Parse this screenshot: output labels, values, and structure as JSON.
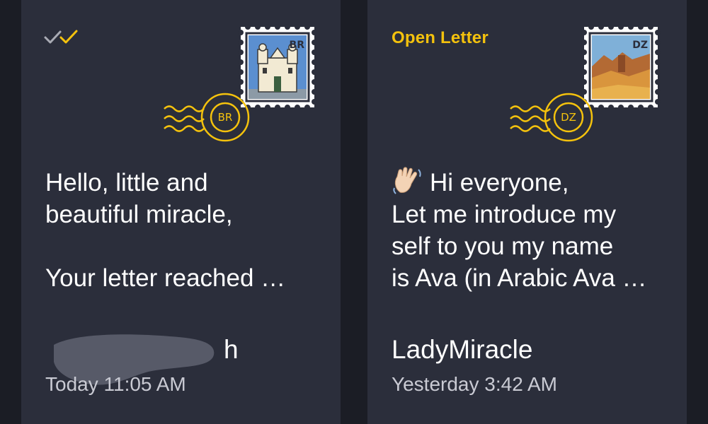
{
  "colors": {
    "background": "#1b1d25",
    "card": "#2b2e3b",
    "accent": "#f4c20d",
    "text": "#ffffff",
    "muted_text": "#c9cad3"
  },
  "letters": [
    {
      "status_icon": "double-check-icon",
      "stamp": {
        "country_code": "BR",
        "picture": "baroque church facade"
      },
      "postmark": {
        "code": "BR"
      },
      "preview_lines": [
        "Hello, little and",
        "beautiful miracle,",
        "",
        "Your letter reached …"
      ],
      "sender": "h",
      "timestamp": "Today 11:05 AM"
    },
    {
      "status_label": "Open Letter",
      "stamp": {
        "country_code": "DZ",
        "picture": "desert canyon landscape"
      },
      "postmark": {
        "code": "DZ"
      },
      "preview_icon": "waving-hand-icon",
      "preview_lines": [
        "Hi everyone,",
        "Let me introduce my",
        "self to you my name",
        "is Ava (in Arabic Ava …"
      ],
      "sender": "LadyMiracle",
      "timestamp": "Yesterday 3:42 AM"
    }
  ]
}
